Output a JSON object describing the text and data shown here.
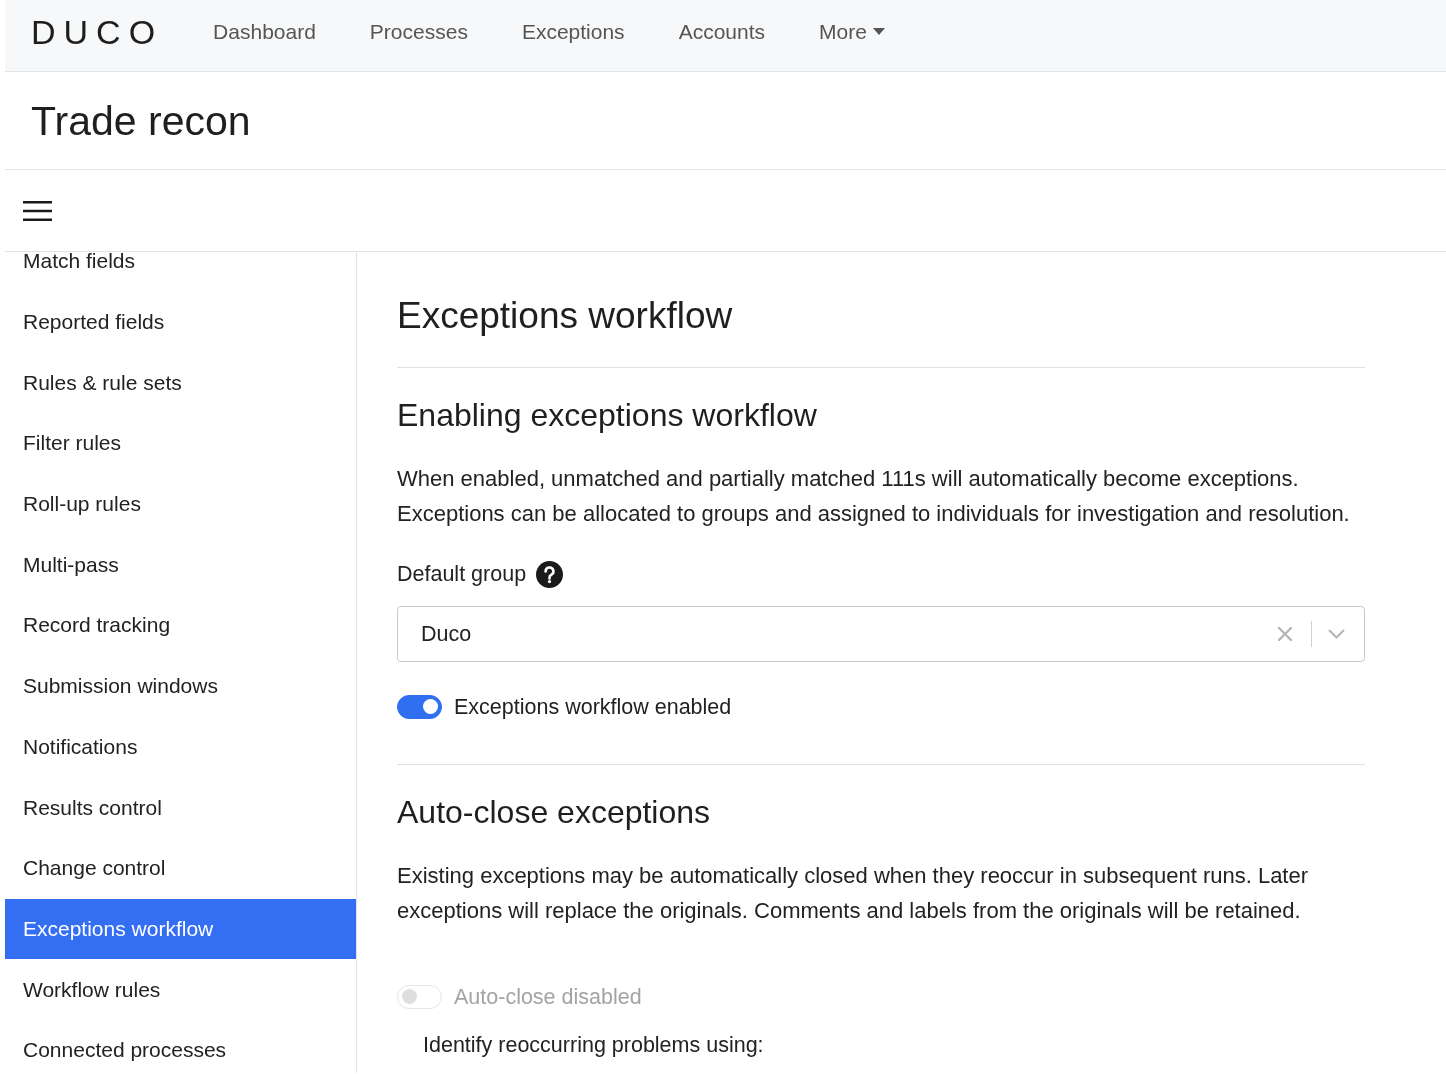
{
  "top_nav": {
    "logo": "DUCO",
    "links": [
      {
        "label": "Dashboard",
        "kind": "link"
      },
      {
        "label": "Processes",
        "kind": "link"
      },
      {
        "label": "Exceptions",
        "kind": "link"
      },
      {
        "label": "Accounts",
        "kind": "link"
      },
      {
        "label": "More",
        "kind": "dropdown"
      }
    ]
  },
  "page_title": "Trade recon",
  "sidebar": {
    "items": [
      {
        "label": "Match fields",
        "selected": false
      },
      {
        "label": "Reported fields",
        "selected": false
      },
      {
        "label": "Rules & rule sets",
        "selected": false
      },
      {
        "label": "Filter rules",
        "selected": false
      },
      {
        "label": "Roll-up rules",
        "selected": false
      },
      {
        "label": "Multi-pass",
        "selected": false
      },
      {
        "label": "Record tracking",
        "selected": false
      },
      {
        "label": "Submission windows",
        "selected": false
      },
      {
        "label": "Notifications",
        "selected": false
      },
      {
        "label": "Results control",
        "selected": false
      },
      {
        "label": "Change control",
        "selected": false
      },
      {
        "label": "Exceptions workflow",
        "selected": true
      },
      {
        "label": "Workflow rules",
        "selected": false
      },
      {
        "label": "Connected processes",
        "selected": false
      }
    ]
  },
  "content": {
    "title": "Exceptions workflow",
    "sections": [
      {
        "heading": "Enabling exceptions workflow",
        "items": [
          {
            "kind": "paragraph",
            "text": "When enabled, unmatched and partially matched 111s will automatically become exceptions. Exceptions can be allocated to groups and assigned to individuals for investigation and resolution."
          },
          {
            "kind": "select",
            "label": "Default group",
            "help": true,
            "value": "Duco"
          },
          {
            "kind": "toggle",
            "label": "Exceptions workflow enabled",
            "on": true,
            "disabled": false
          }
        ]
      },
      {
        "heading": "Auto-close exceptions",
        "items": [
          {
            "kind": "paragraph",
            "text": "Existing exceptions may be automatically closed when they reoccur in subsequent runs. Later exceptions will replace the originals. Comments and labels from the originals will be retained."
          },
          {
            "kind": "toggle",
            "label": "Auto-close disabled",
            "on": false,
            "disabled": true
          },
          {
            "kind": "label",
            "text": "Identify reoccurring problems using:"
          }
        ]
      }
    ]
  }
}
